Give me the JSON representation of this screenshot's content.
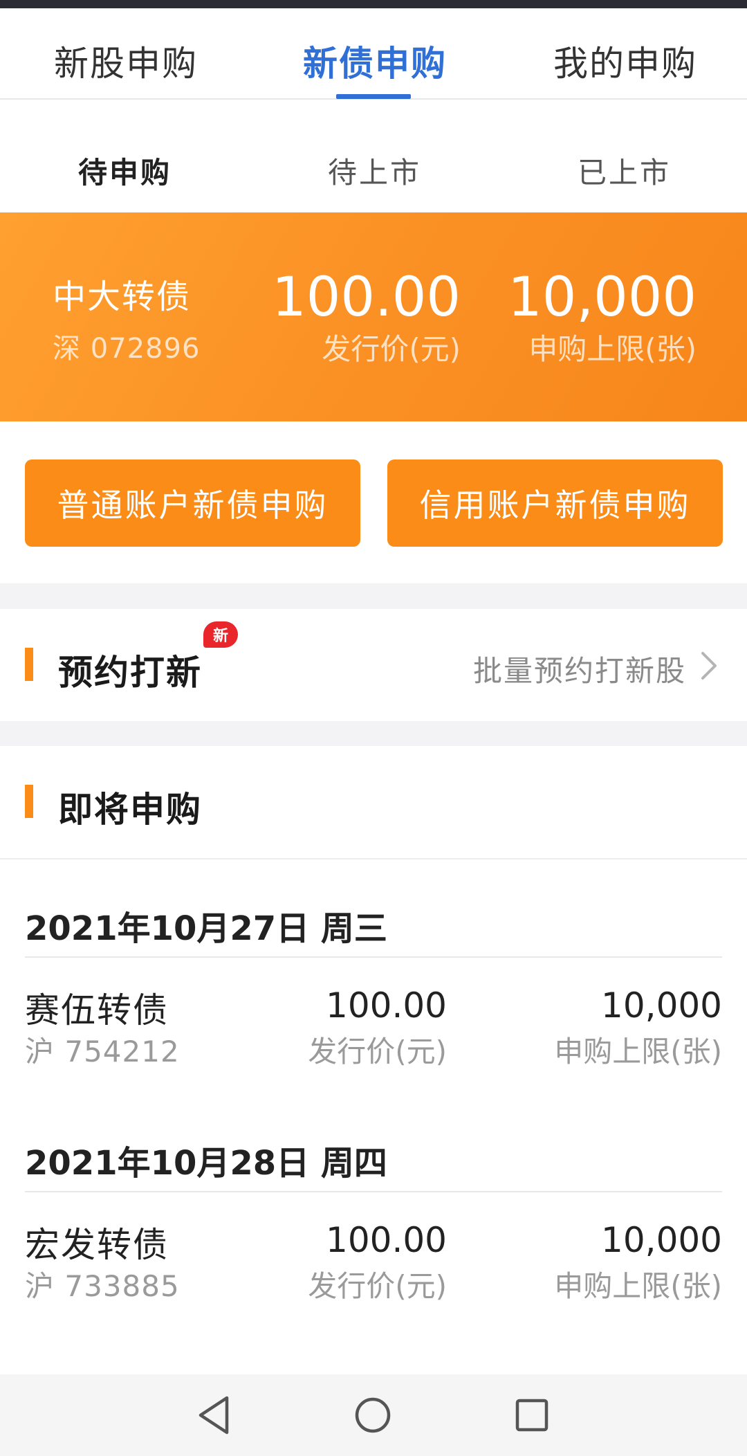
{
  "top_tabs": [
    {
      "label": "新股申购"
    },
    {
      "label": "新债申购"
    },
    {
      "label": "我的申购"
    }
  ],
  "active_top_tab": "新债申购",
  "sub_tabs": [
    {
      "label": "待申购"
    },
    {
      "label": "待上市"
    },
    {
      "label": "已上市"
    }
  ],
  "active_sub_tab": "待申购",
  "featured": {
    "name": "中大转债",
    "code": "深 072896",
    "price": "100.00",
    "price_label": "发行价(元)",
    "limit": "10,000",
    "limit_label": "申购上限(张)"
  },
  "buttons": {
    "normal": "普通账户新债申购",
    "credit": "信用账户新债申购"
  },
  "reserve": {
    "title": "预约打新",
    "badge": "新",
    "link": "批量预约打新股"
  },
  "upcoming": {
    "title": "即将申购",
    "groups": [
      {
        "date": "2021年10月27日 周三",
        "name": "赛伍转债",
        "code": "沪 754212",
        "price": "100.00",
        "price_label": "发行价(元)",
        "limit": "10,000",
        "limit_label": "申购上限(张)"
      },
      {
        "date": "2021年10月28日 周四",
        "name": "宏发转债",
        "code": "沪 733885",
        "price": "100.00",
        "price_label": "发行价(元)",
        "limit": "10,000",
        "limit_label": "申购上限(张)"
      }
    ]
  },
  "colors": {
    "accent_blue": "#2f6fd6",
    "accent_orange": "#fb8c18",
    "badge_red": "#e8262b"
  },
  "icons": {
    "nav_back": "triangle-back-icon",
    "nav_home": "circle-home-icon",
    "nav_recent": "square-recent-icon",
    "link_arrow": "chevron-right-icon"
  }
}
